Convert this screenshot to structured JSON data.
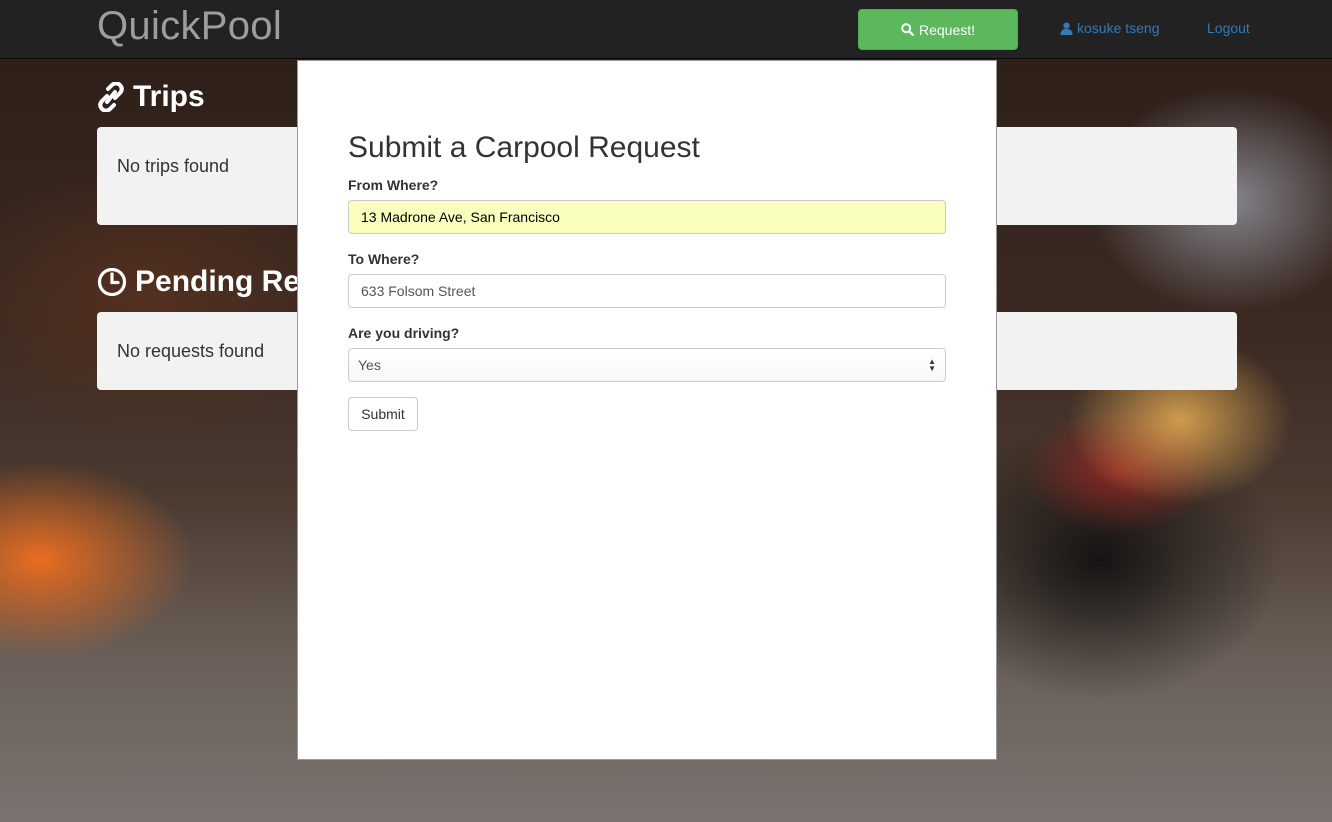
{
  "navbar": {
    "brand": "QuickPool",
    "request_button": "Request!",
    "user_link": "kosuke tseng",
    "logout_link": "Logout"
  },
  "sections": {
    "trips_title": "Trips",
    "trips_empty": "No trips found",
    "pending_title": "Pending Requests",
    "pending_empty": "No requests found"
  },
  "modal": {
    "title": "Submit a Carpool Request",
    "from_label": "From Where?",
    "from_value": "13 Madrone Ave, San Francisco",
    "to_label": "To Where?",
    "to_value": "633 Folsom Street",
    "driving_label": "Are you driving?",
    "driving_selected": "Yes",
    "submit_label": "Submit"
  },
  "colors": {
    "navbar_bg": "#222222",
    "brand_text": "#9d9d9d",
    "request_button_bg": "#5cb85c",
    "link": "#337ab7",
    "autofill_bg": "#faffbd"
  }
}
